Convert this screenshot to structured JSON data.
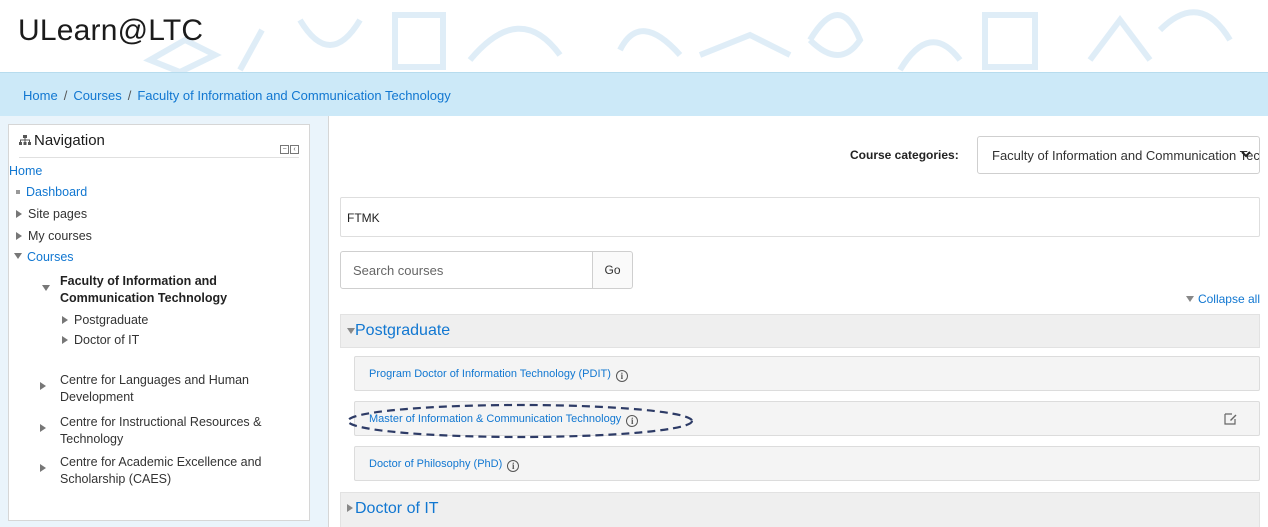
{
  "header": {
    "site_title": "ULearn@LTC"
  },
  "breadcrumb": [
    "Home",
    "Courses",
    "Faculty of Information and Communication Technology"
  ],
  "navigation": {
    "title": "Navigation",
    "home": "Home",
    "dashboard": "Dashboard",
    "site_pages": "Site pages",
    "my_courses": "My courses",
    "courses": "Courses",
    "faculty": "Faculty of Information and Communication Technology",
    "postgraduate": "Postgraduate",
    "doctor_it": "Doctor of IT",
    "centre_languages": "Centre for Languages and Human Development",
    "centre_instructional": "Centre for Instructional Resources & Technology",
    "centre_academic": "Centre for Academic Excellence and Scholarship (CAES)"
  },
  "main": {
    "course_categories_label": "Course categories:",
    "selected_category": "Faculty of Information and Communication Technology",
    "category_description": "FTMK",
    "search_placeholder": "Search courses",
    "go_label": "Go",
    "collapse_all": "Collapse all",
    "categories": [
      {
        "name": "Postgraduate",
        "courses": [
          "Program Doctor of Information Technology (PDIT)",
          "Master of Information & Communication Technology",
          "Doctor of Philosophy (PhD)"
        ]
      },
      {
        "name": "Doctor of IT"
      }
    ]
  },
  "icons": {
    "info": "info-icon",
    "edit": "edit-icon",
    "sitemap": "sitemap-icon",
    "chevron": "chevron-down-icon"
  },
  "colors": {
    "link": "#1177d1",
    "breadcrumb_bar": "#cce9f8",
    "page_bg": "#eaf4fb",
    "highlight_ellipse": "#2d3b66"
  }
}
